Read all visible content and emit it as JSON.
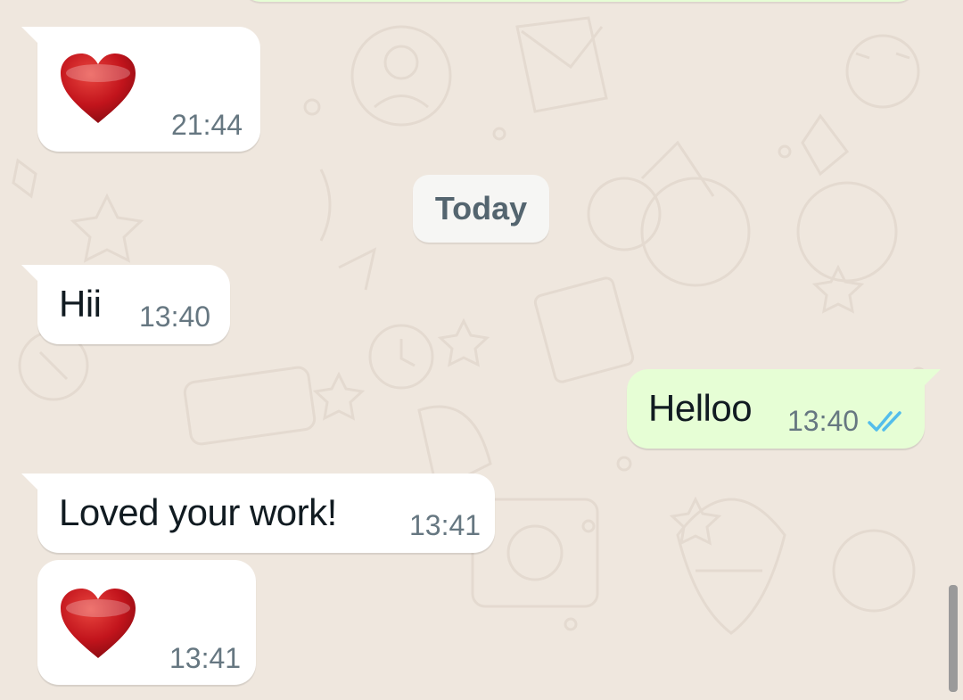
{
  "chat": {
    "date_separator": "Today",
    "messages": [
      {
        "direction": "incoming",
        "kind": "emoji",
        "emoji": "heart-emoji",
        "time": "21:44"
      },
      {
        "direction": "incoming",
        "kind": "text",
        "text": "Hii",
        "time": "13:40"
      },
      {
        "direction": "outgoing",
        "kind": "text",
        "text": "Helloo",
        "time": "13:40",
        "status": "read"
      },
      {
        "direction": "incoming",
        "kind": "text",
        "text": "Loved your work!",
        "time": "13:41"
      },
      {
        "direction": "incoming",
        "kind": "emoji",
        "emoji": "heart-emoji",
        "time": "13:41"
      }
    ]
  },
  "colors": {
    "background": "#efe7de",
    "incoming_bubble": "#ffffff",
    "outgoing_bubble": "#e6fed5",
    "read_ticks": "#53bdeb"
  }
}
